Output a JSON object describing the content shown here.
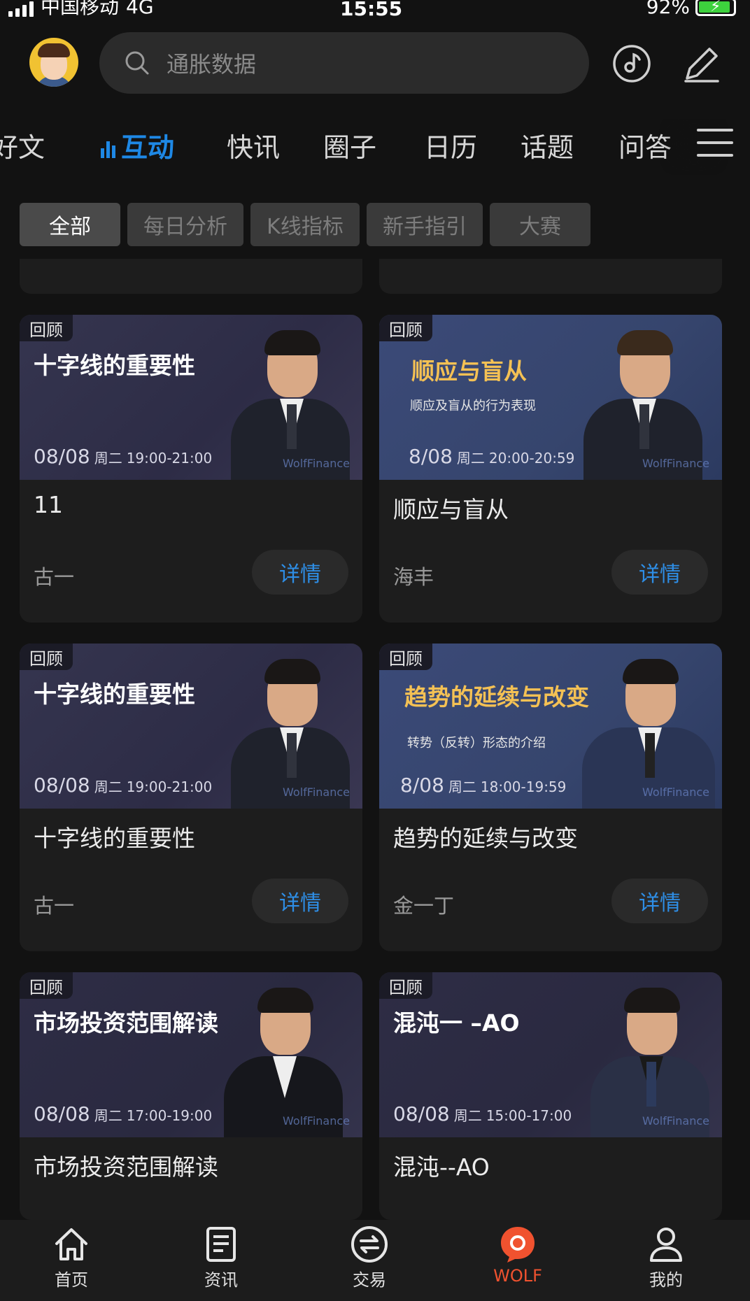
{
  "status_bar": {
    "carrier": "中国移动",
    "network": "4G",
    "time": "15:55",
    "battery": "92%",
    "battery_level": 0.92
  },
  "header": {
    "search_placeholder": "通胀数据"
  },
  "tabs": [
    {
      "label": "好文",
      "active": false
    },
    {
      "label": "互动",
      "active": true
    },
    {
      "label": "快讯",
      "active": false
    },
    {
      "label": "圈子",
      "active": false
    },
    {
      "label": "日历",
      "active": false
    },
    {
      "label": "话题",
      "active": false
    },
    {
      "label": "问答",
      "active": false
    }
  ],
  "chips": [
    "全部",
    "每日分析",
    "K线指标",
    "新手指引",
    "大赛"
  ],
  "cards": [
    {
      "badge": "回顾",
      "thumb_title": "十字线的重要性",
      "thumb_subtitle": "",
      "thumb_date": "08/08",
      "thumb_weekday": "周二",
      "thumb_time": "19:00-21:00",
      "title": "11",
      "author": "古一",
      "button": "详情",
      "watermark": "WolfFinance"
    },
    {
      "badge": "回顾",
      "thumb_title": "顺应与盲从",
      "thumb_subtitle": "顺应及盲从的行为表现",
      "thumb_date": "8/08",
      "thumb_weekday": "周二",
      "thumb_time": "20:00-20:59",
      "title": "顺应与盲从",
      "author": "海丰",
      "button": "详情",
      "watermark": "WolfFinance"
    },
    {
      "badge": "回顾",
      "thumb_title": "十字线的重要性",
      "thumb_subtitle": "",
      "thumb_date": "08/08",
      "thumb_weekday": "周二",
      "thumb_time": "19:00-21:00",
      "title": "十字线的重要性",
      "author": "古一",
      "button": "详情",
      "watermark": "WolfFinance"
    },
    {
      "badge": "回顾",
      "thumb_title": "趋势的延续与改变",
      "thumb_subtitle": "转势（反转）形态的介绍",
      "thumb_date": "8/08",
      "thumb_weekday": "周二",
      "thumb_time": "18:00-19:59",
      "title": "趋势的延续与改变",
      "author": "金一丁",
      "button": "详情",
      "watermark": "WolfFinance"
    },
    {
      "badge": "回顾",
      "thumb_title": "市场投资范围解读",
      "thumb_subtitle": "",
      "thumb_date": "08/08",
      "thumb_weekday": "周二",
      "thumb_time": "17:00-19:00",
      "title": "市场投资范围解读",
      "author": "",
      "button": "",
      "watermark": "WolfFinance"
    },
    {
      "badge": "回顾",
      "thumb_title": "混沌一 –AO",
      "thumb_subtitle": "",
      "thumb_date": "08/08",
      "thumb_weekday": "周二",
      "thumb_time": "15:00-17:00",
      "title": "混沌--AO",
      "author": "",
      "button": "",
      "watermark": "WolfFinance"
    }
  ],
  "bottom_nav": [
    {
      "label": "首页",
      "icon": "home-icon",
      "active": false
    },
    {
      "label": "资讯",
      "icon": "news-icon",
      "active": false
    },
    {
      "label": "交易",
      "icon": "exchange-icon",
      "active": false
    },
    {
      "label": "WOLF",
      "icon": "wolf-icon",
      "active": true
    },
    {
      "label": "我的",
      "icon": "profile-icon",
      "active": false
    }
  ],
  "colors": {
    "accent_blue": "#1e88e5",
    "active_orange": "#f0522f",
    "background": "#121212",
    "gold_title": "#f4c154"
  }
}
